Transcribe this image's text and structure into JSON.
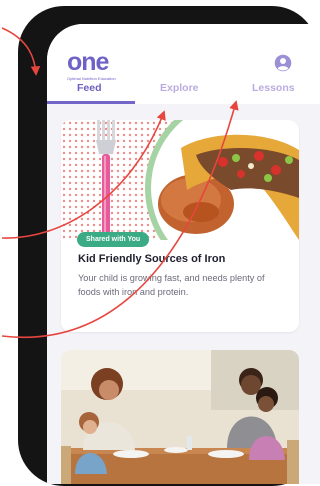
{
  "app": {
    "logo_text": "one",
    "logo_subtitle": "Optimal Nutrition Education"
  },
  "tabs": [
    {
      "label": "Feed",
      "active": true
    },
    {
      "label": "Explore",
      "active": false
    },
    {
      "label": "Lessons",
      "active": false
    }
  ],
  "feed": {
    "card1": {
      "badge": "Shared with You",
      "title": "Kid Friendly Sources of Iron",
      "description": "Your child is growing fast, and needs plenty of foods with iron and protein.",
      "image": "tacos-with-rice-and-fork"
    },
    "card2": {
      "image": "family-eating-dinner-photo"
    }
  },
  "colors": {
    "brand_purple": "#6f62c6",
    "brand_green": "#35b58a",
    "badge_green": "#3aab84",
    "inactive_tab": "#b9acdf",
    "annotation_arrow": "#e6463e"
  }
}
